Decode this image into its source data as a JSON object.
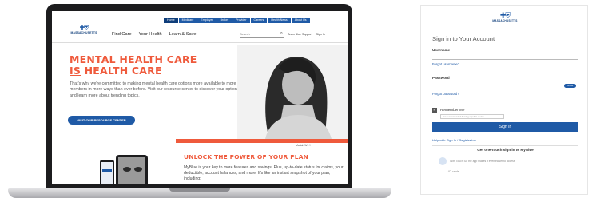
{
  "laptop_site": {
    "topbar": [
      "Home",
      "Medicare",
      "Employer",
      "Broker",
      "Provider",
      "Careers",
      "Health News",
      "About Us"
    ],
    "logo_text": "MASSACHUSETTS",
    "nav": [
      "Find Care",
      "Your Health",
      "Learn & Save"
    ],
    "search_placeholder": "Search",
    "util_links": [
      "Team Blue Support",
      "Sign In"
    ],
    "hero_line1": "MENTAL HEALTH CARE",
    "hero_line2_em": "IS",
    "hero_line2_rest": " HEALTH CARE",
    "hero_body": "That's why we're committed to making mental health care options more available to more members in more ways than ever before. Visit our resource center to discover your options and learn more about trending topics.",
    "hero_cta": "VISIT OUR RESOURCE CENTER",
    "photo_credit": "Mariah W. ☉",
    "unlock_title": "UNLOCK THE POWER OF YOUR PLAN",
    "unlock_body": "MyBlue is your key to more features and savings. Plus, up-to-date status for claims, your deductible, account balances, and more. It's like an instant snapshot of your plan, including:"
  },
  "signin": {
    "logo_text": "MASSACHUSETTS",
    "title": "Sign in to Your Account",
    "username_label": "Username",
    "forgot_username": "Forgot username?",
    "password_label": "Password",
    "show_label": "Show",
    "forgot_password": "Forgot password?",
    "remember_label": "Remember Me",
    "remember_note": "Not recommended if using a public device",
    "sign_in_button": "Sign In",
    "help_link": "Help with Sign In / Registration",
    "touch_heading": "Get one-touch sign in to MyBlue",
    "touch_text": "With Touch ID, the app makes it even easier to access",
    "touch_bullet": "ID cards"
  },
  "colors": {
    "brand_blue": "#1f5aa6",
    "accent_coral": "#ef5a3c"
  }
}
